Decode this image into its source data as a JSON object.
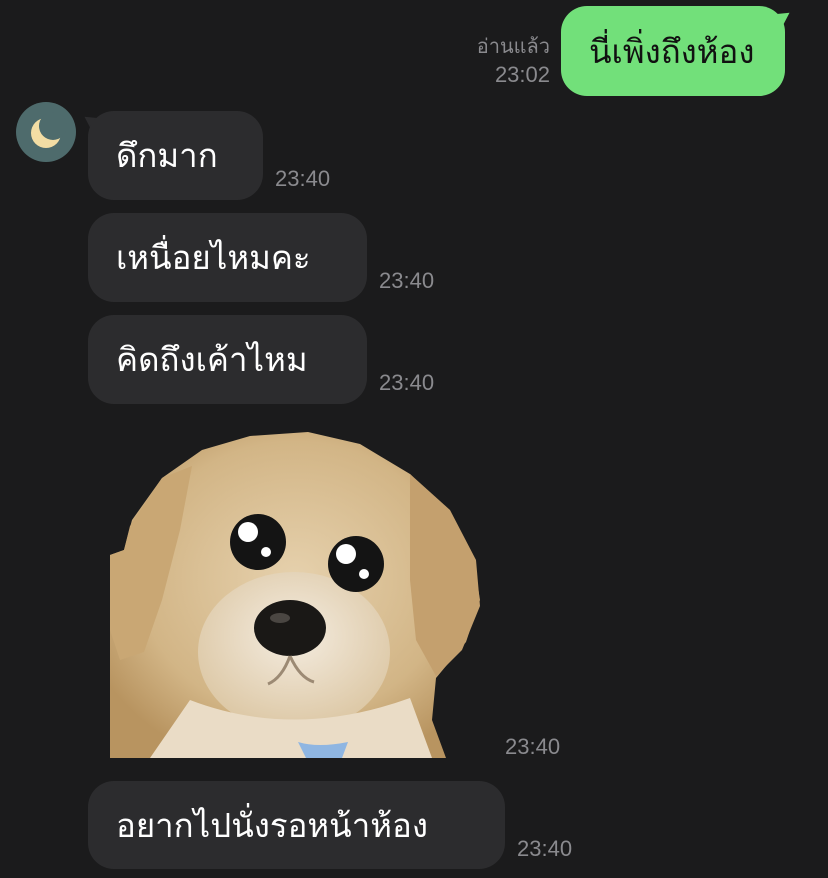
{
  "chat": {
    "outgoing": {
      "text": "นี่เพิ่งถึงห้อง",
      "status": "อ่านแล้ว",
      "time": "23:02"
    },
    "incoming": [
      {
        "text": "ดึกมาก",
        "time": "23:40"
      },
      {
        "text": "เหนื่อยไหมคะ",
        "time": "23:40"
      },
      {
        "text": "คิดถึงเค้าไหม",
        "time": "23:40"
      },
      {
        "sticker": "puppy-sticker",
        "time": "23:40"
      },
      {
        "text": "อยากไปนั่งรอหน้าห้อง",
        "time": "23:40"
      }
    ]
  },
  "contact": {
    "avatar_icon": "moon-icon"
  },
  "colors": {
    "background": "#1b1b1c",
    "incoming_bubble": "#2c2c2e",
    "outgoing_bubble": "#72e07a",
    "timestamp": "#8a8a8e",
    "avatar_background": "#4e6b6c"
  }
}
